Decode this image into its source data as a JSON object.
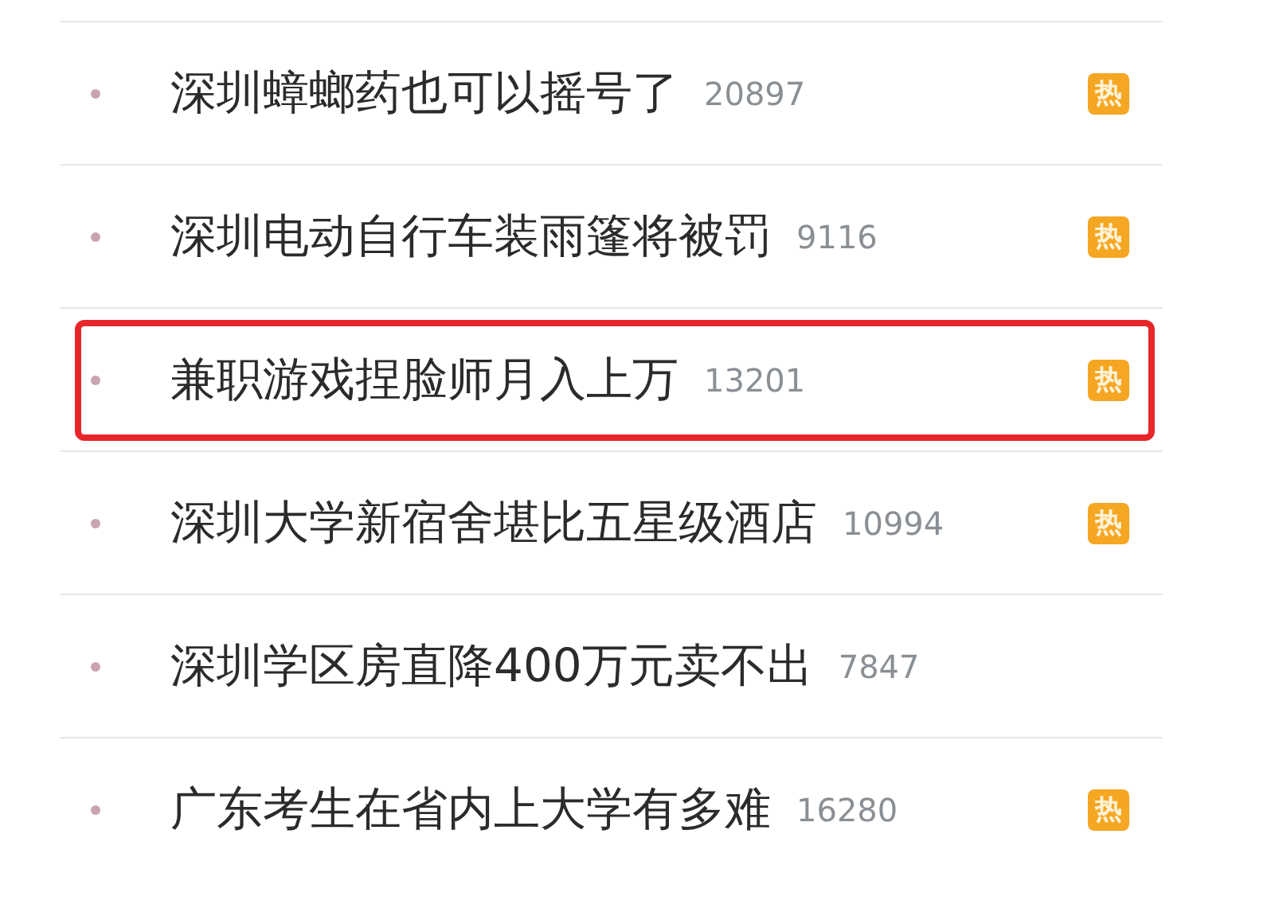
{
  "hot_list": [
    {
      "title": "深圳蟑螂药也可以摇号了",
      "count": "20897",
      "badge": "热",
      "highlighted": false
    },
    {
      "title": "深圳电动自行车装雨篷将被罚",
      "count": "9116",
      "badge": "热",
      "highlighted": false
    },
    {
      "title": "兼职游戏捏脸师月入上万",
      "count": "13201",
      "badge": "热",
      "highlighted": true
    },
    {
      "title": "深圳大学新宿舍堪比五星级酒店",
      "count": "10994",
      "badge": "热",
      "highlighted": false
    },
    {
      "title": "深圳学区房直降400万元卖不出",
      "count": "7847",
      "highlighted": false
    },
    {
      "title": "广东考生在省内上大学有多难",
      "count": "16280",
      "badge": "热",
      "highlighted": false
    }
  ]
}
